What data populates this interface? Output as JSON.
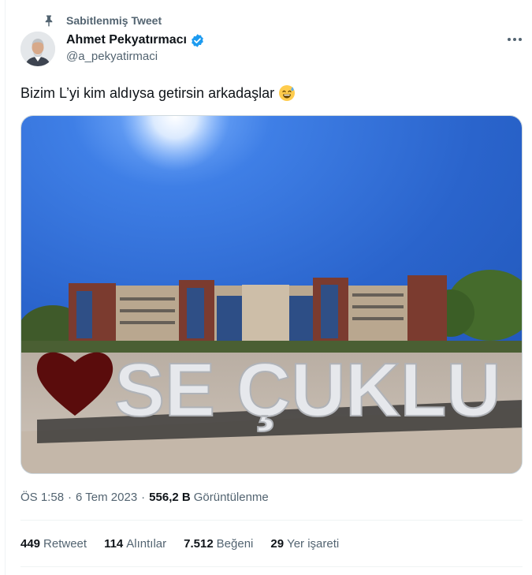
{
  "pinned": {
    "label": "Sabitlenmiş Tweet",
    "icon": "pin-icon"
  },
  "author": {
    "display_name": "Ahmet Pekyatırmacı",
    "handle": "@a_pekyatirmaci",
    "verified_icon": "verified-badge-icon",
    "verified_color": "#1d9bf0"
  },
  "more_icon": "more-horizontal-icon",
  "tweet": {
    "text": "Bizim L’yi kim aldıysa getirsin arkadaşlar",
    "emoji": "grinning-face-with-sweat-emoji"
  },
  "media": {
    "description_icon": "photo",
    "sign_text": "SE ÇUKLU",
    "heart_color": "#5a0c0c"
  },
  "meta": {
    "time": "ÖS 1:58",
    "separator": "·",
    "date": "6 Tem 2023",
    "views_count": "556,2 B",
    "views_label": "Görüntülenme"
  },
  "stats": [
    {
      "count": "449",
      "label": "Retweet"
    },
    {
      "count": "114",
      "label": "Alıntılar"
    },
    {
      "count": "7.512",
      "label": "Beğeni"
    },
    {
      "count": "29",
      "label": "Yer işareti"
    }
  ],
  "colors": {
    "text_primary": "#0f1419",
    "text_secondary": "#536471",
    "divider": "#eff3f4",
    "accent": "#1d9bf0"
  }
}
